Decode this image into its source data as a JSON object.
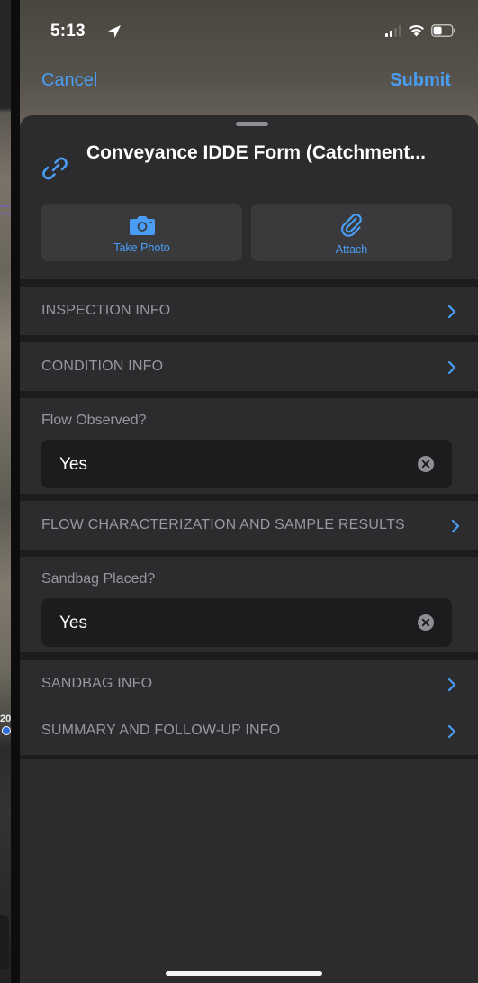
{
  "status_bar": {
    "time": "5:13"
  },
  "nav": {
    "cancel_label": "Cancel",
    "submit_label": "Submit"
  },
  "form": {
    "title": "Conveyance IDDE Form (Catchment..."
  },
  "actions": {
    "take_photo_label": "Take Photo",
    "attach_label": "Attach"
  },
  "sections": {
    "inspection_info": "INSPECTION INFO",
    "condition_info": "CONDITION INFO",
    "flow_characterization": "FLOW CHARACTERIZATION AND SAMPLE RESULTS",
    "sandbag_info": "SANDBAG INFO",
    "summary_followup": "SUMMARY AND FOLLOW-UP INFO"
  },
  "fields": {
    "flow_observed": {
      "label": "Flow Observed?",
      "value": "Yes"
    },
    "sandbag_placed": {
      "label": "Sandbag Placed?",
      "value": "Yes"
    }
  },
  "map": {
    "partial_label": "20"
  },
  "colors": {
    "accent": "#4a9df5",
    "sheet_bg": "#2c2c2e",
    "field_bg": "#1c1c1e",
    "section_text": "#98989d"
  },
  "icons": {
    "location_arrow": "location-arrow-icon",
    "signal": "signal-icon",
    "wifi": "wifi-icon",
    "battery": "battery-icon",
    "link": "link-icon",
    "camera": "camera-icon",
    "paperclip": "paperclip-icon",
    "chevron": "chevron-right-icon",
    "clear": "clear-icon"
  }
}
